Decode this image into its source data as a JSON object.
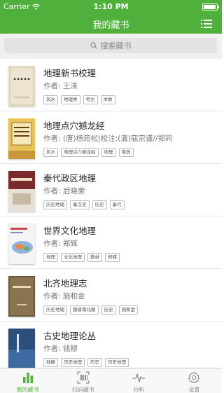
{
  "status_bar": {
    "carrier": "Carrier",
    "time": "1:10 PM",
    "battery_level": 0.95
  },
  "nav": {
    "title": "我的藏书"
  },
  "search": {
    "placeholder": "搜索藏书"
  },
  "books": [
    {
      "title": "地理新书校理",
      "author": "作者: 王洙",
      "tags": [
        "风水",
        "地理类",
        "考古",
        "术数"
      ]
    },
    {
      "title": "地理点穴撼龙经",
      "author": "作者: (唐)杨筠松|校注:(清)寇宗谨//郑同",
      "tags": [
        "风水",
        "地理点穴撼龙经",
        "地理",
        "堪舆"
      ]
    },
    {
      "title": "秦代政区地理",
      "author": "作者: 后晓荣",
      "tags": [
        "历史地理",
        "秦汉史",
        "历史",
        "秦代"
      ]
    },
    {
      "title": "世界文化地理",
      "author": "作者: 郑辉",
      "tags": [
        "地理",
        "文化地理",
        "教材",
        "郑辉"
      ]
    },
    {
      "title": "北齐地理志",
      "author": "作者: 施和金",
      "tags": [
        "历史地理",
        "魏晋南北朝",
        "历史",
        "施和金"
      ]
    },
    {
      "title": "古史地理论丛",
      "author": "作者: 钱穆",
      "tags": [
        "钱穆",
        "历史地理",
        "历史",
        "历史地理"
      ]
    }
  ],
  "tabs": [
    {
      "label": "我的藏书",
      "icon": "bar-chart-icon",
      "active": true
    },
    {
      "label": "扫码藏书",
      "icon": "barcode-scan-icon",
      "active": false
    },
    {
      "label": "分析",
      "icon": "pulse-icon",
      "active": false
    },
    {
      "label": "设置",
      "icon": "gear-icon",
      "active": false
    }
  ],
  "colors": {
    "accent": "#4fb13c",
    "tab_inactive": "#8a8a8a"
  }
}
